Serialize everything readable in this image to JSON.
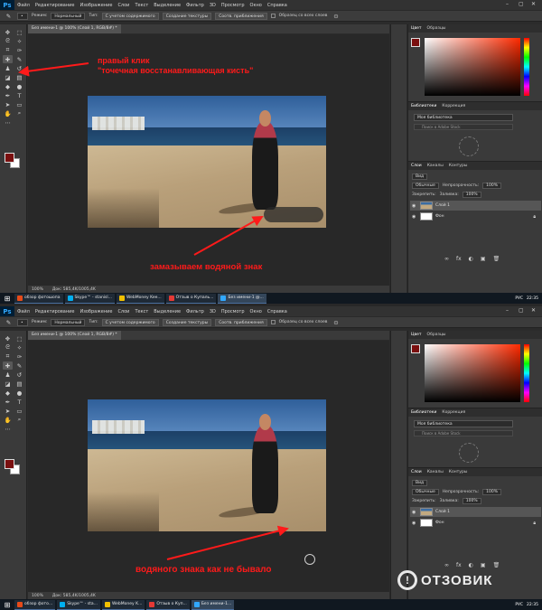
{
  "app": {
    "logo": "Ps",
    "menu": [
      "Файл",
      "Редактирование",
      "Изображение",
      "Слои",
      "Текст",
      "Выделение",
      "Фильтр",
      "3D",
      "Просмотр",
      "Окно",
      "Справка"
    ],
    "window_controls": [
      "–",
      "▢",
      "✕"
    ]
  },
  "options_bar": {
    "mode_label": "Режим:",
    "mode_value": "Нормальный",
    "type_label": "Тип:",
    "content_aware_btn": "С учетом содержимого",
    "create_texture_btn": "Создание текстуры",
    "proximity_btn": "Соотв. приближения",
    "sample_all_layers": "Образец со всех слоев"
  },
  "document": {
    "tab_title": "Без имени-1 @ 100% (Слой 1, RGB/8#) *",
    "zoom": "100%",
    "doc_size": "Док: 585,4K/1005,4K"
  },
  "panels": {
    "color_tab": "Цвет",
    "swatches_tab": "Образцы",
    "libraries_tab": "Библиотеки",
    "adjustments_tab": "Коррекция",
    "library_name": "Моя библиотека",
    "library_search_placeholder": "Поиск в Adobe Stock",
    "layers_tab": "Слои",
    "channels_tab": "Каналы",
    "paths_tab": "Контуры",
    "kind_filter": "Вид",
    "blend_mode": "Обычные",
    "opacity_label": "Непрозрачность:",
    "opacity_value": "100%",
    "lock_label": "Закрепить:",
    "fill_label": "Заливка:",
    "fill_value": "100%",
    "layers": [
      {
        "name": "Слой 1"
      },
      {
        "name": "Фон"
      }
    ]
  },
  "annotations": {
    "top_line1": "правый клик",
    "top_line2": "\"точечная восстанавливающая кисть\"",
    "top_line3": "замазываем водяной знак",
    "bottom_line1": "водяного знака как не бывало"
  },
  "taskbar": {
    "items_top": [
      "обзор фотошопа",
      "Skype™ - stanisl...",
      "WebMoney Kee...",
      "Отзыв о Купаль...",
      "Без имени-1 @..."
    ],
    "items_bottom": [
      "обзор фото...",
      "Skype™ - sta...",
      "WebMoney K...",
      "Отзыв о Куп...",
      "Без имени-1..."
    ],
    "lang": "РУС",
    "time_top": "22:35",
    "time_bottom": "22:35"
  },
  "watermark_site": "ОТЗОВИК",
  "colors": {
    "foreground": "#7a0f0f",
    "annotation": "#ff1a1a",
    "ps_accent": "#31a8ff"
  }
}
